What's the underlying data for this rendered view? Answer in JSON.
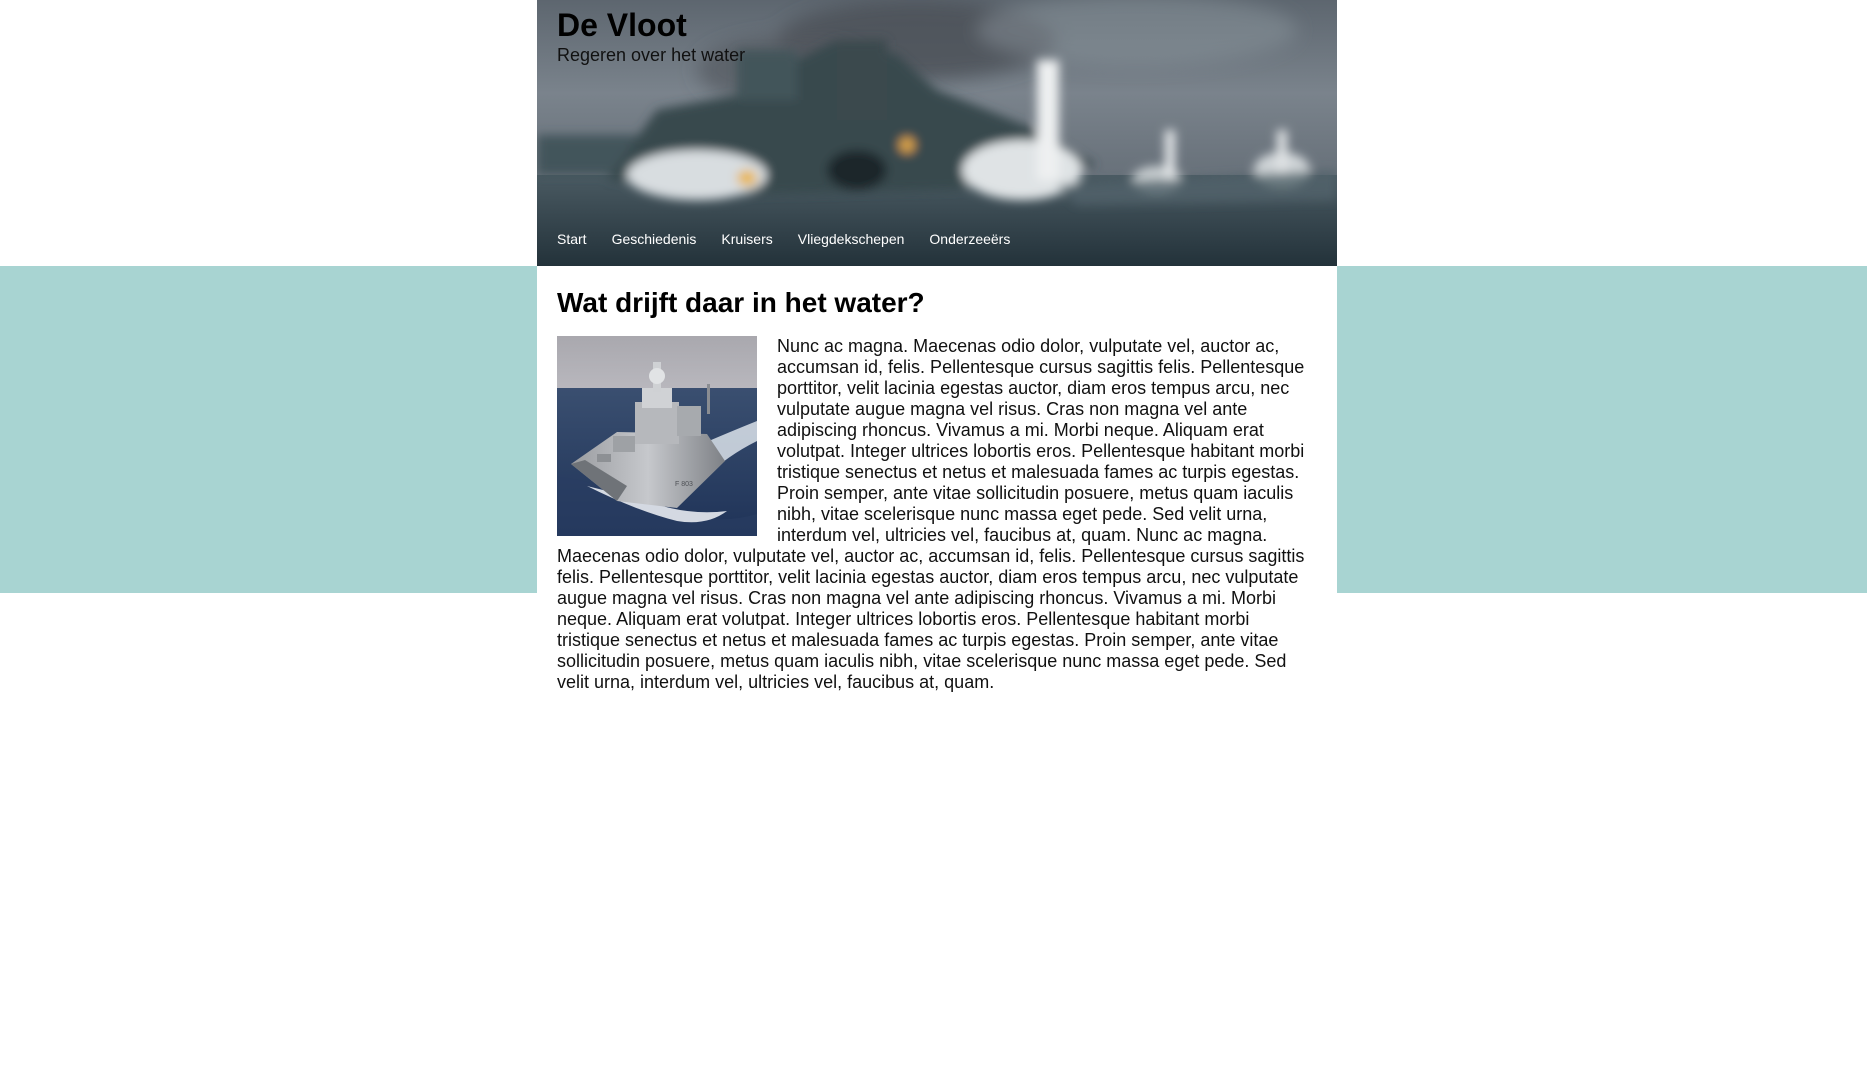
{
  "site": {
    "title": "De Vloot",
    "tagline": "Regeren over het water"
  },
  "nav": {
    "items": [
      {
        "label": "Start"
      },
      {
        "label": "Geschiedenis"
      },
      {
        "label": "Kruisers"
      },
      {
        "label": "Vliegdekschepen"
      },
      {
        "label": "Onderzeeërs"
      }
    ]
  },
  "main": {
    "heading": "Wat drijft daar in het water?",
    "body": "Nunc ac magna. Maecenas odio dolor, vulputate vel, auctor ac, accumsan id, felis. Pellentesque cursus sagittis felis. Pellentesque porttitor, velit lacinia egestas auctor, diam eros tempus arcu, nec vulputate augue magna vel risus. Cras non magna vel ante adipiscing rhoncus. Vivamus a mi. Morbi neque. Aliquam erat volutpat. Integer ultrices lobortis eros. Pellentesque habitant morbi tristique senectus et netus et malesuada fames ac turpis egestas. Proin semper, ante vitae sollicitudin posuere, metus quam iaculis nibh, vitae scelerisque nunc massa eget pede. Sed velit urna, interdum vel, ultricies vel, faucibus at, quam. Nunc ac magna. Maecenas odio dolor, vulputate vel, auctor ac, accumsan id, felis. Pellentesque cursus sagittis felis. Pellentesque porttitor, velit lacinia egestas auctor, diam eros tempus arcu, nec vulputate augue magna vel risus. Cras non magna vel ante adipiscing rhoncus. Vivamus a mi. Morbi neque. Aliquam erat volutpat. Integer ultrices lobortis eros. Pellentesque habitant morbi tristique senectus et netus et malesuada fames ac turpis egestas. Proin semper, ante vitae sollicitudin posuere, metus quam iaculis nibh, vitae scelerisque nunc massa eget pede. Sed velit urna, interdum vel, ultricies vel, faucibus at, quam."
  },
  "colors": {
    "band": "#a8d4d2",
    "page": "#ffffff",
    "nav_text": "#ffffff"
  }
}
